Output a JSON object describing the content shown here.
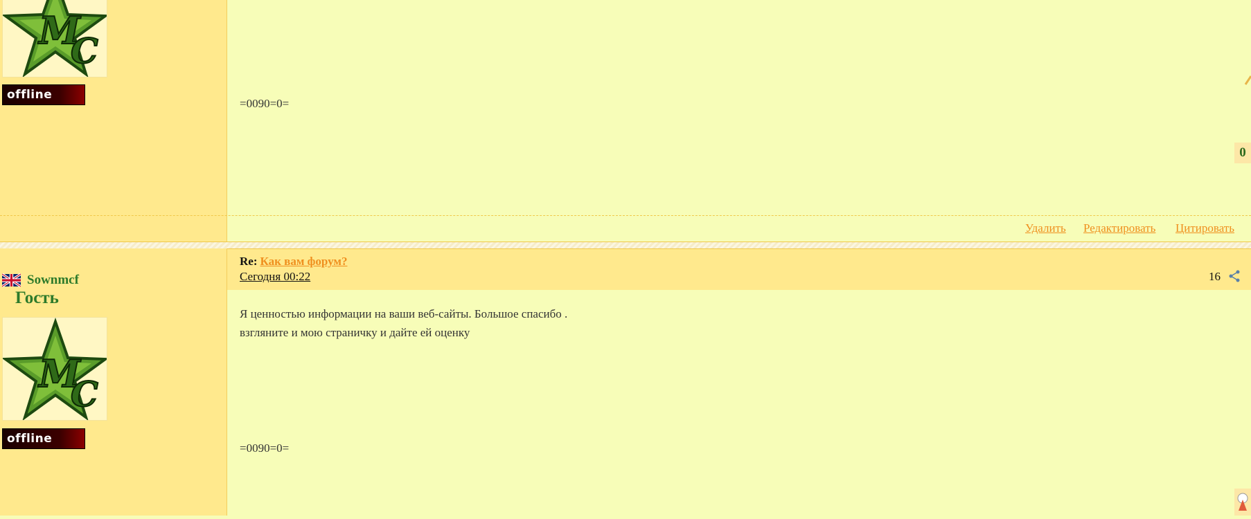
{
  "post1": {
    "body_text": "=0090=0=",
    "status_badge": "offline",
    "rating": "0",
    "actions": {
      "delete": "Удалить",
      "edit": "Редактировать",
      "quote": "Цитировать"
    }
  },
  "post2": {
    "username": "Sownmcf",
    "rank": "Гость",
    "status_badge": "offline",
    "re_label": "Re:",
    "topic_title": "Как вам форум?",
    "date": "Сегодня 00:22",
    "post_number": "16",
    "body_lines": [
      "Я ценностью информации на ваши веб-сайты. Большое спасибо .",
      "взгляните и мою страничку и дайте ей оценку"
    ],
    "signature": "=0090=0="
  },
  "colors": {
    "background": "#f7fdb8",
    "sidebar": "#ffe98d",
    "link": "#ef8f1e",
    "username": "#2d7a2a"
  }
}
